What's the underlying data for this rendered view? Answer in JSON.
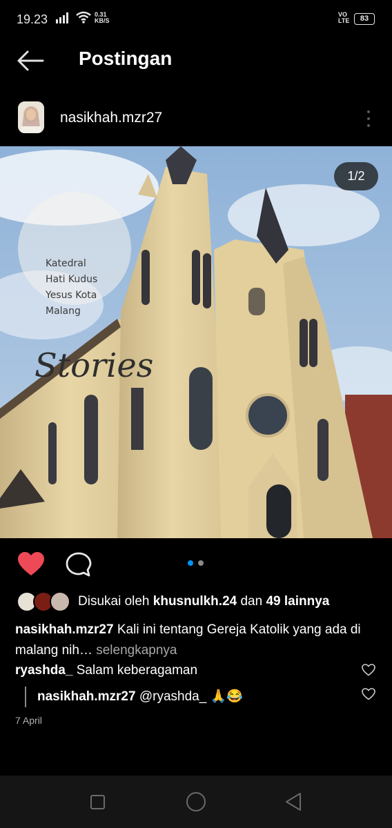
{
  "status_bar": {
    "time": "19.23",
    "net_speed_value": "0.31",
    "net_speed_unit": "KB/S",
    "volte_top": "VO",
    "volte_bottom": "LTE",
    "battery": "83"
  },
  "header": {
    "title": "Postingan"
  },
  "post": {
    "owner": "nasikhah.mzr27",
    "image_counter": "1/2",
    "image_text": {
      "script_title": "Stories",
      "line1": "Katedral",
      "line2": "Hati Kudus",
      "line3": "Yesus Kota",
      "line4": "Malang"
    },
    "carousel_dots": 2,
    "active_dot": 0,
    "liked": true,
    "likes": {
      "prefix": "Disukai oleh",
      "user": "khusnulkh.24",
      "middle": "dan",
      "others": "49 lainnya"
    },
    "caption": {
      "user": "nasikhah.mzr27",
      "text": "Kali ini tentang Gereja Katolik yang ada di malang nih…",
      "more": "selengkapnya"
    },
    "comment": {
      "user": "ryashda_",
      "text": "Salam keberagaman"
    },
    "reply": {
      "user": "nasikhah.mzr27",
      "text": "@ryashda_ 🙏😂"
    },
    "date": "7 April"
  },
  "colors": {
    "background": "#000000",
    "like_red": "#ed4956",
    "active_dot": "#0095f6",
    "muted_text": "#a8a8a8"
  },
  "icons": {
    "back": "arrow-left-icon",
    "more": "more-vertical-icon",
    "like": "heart-filled-icon",
    "comment": "comment-bubble-icon",
    "nav_recents": "square-icon",
    "nav_home": "circle-icon",
    "nav_back": "triangle-back-icon"
  }
}
